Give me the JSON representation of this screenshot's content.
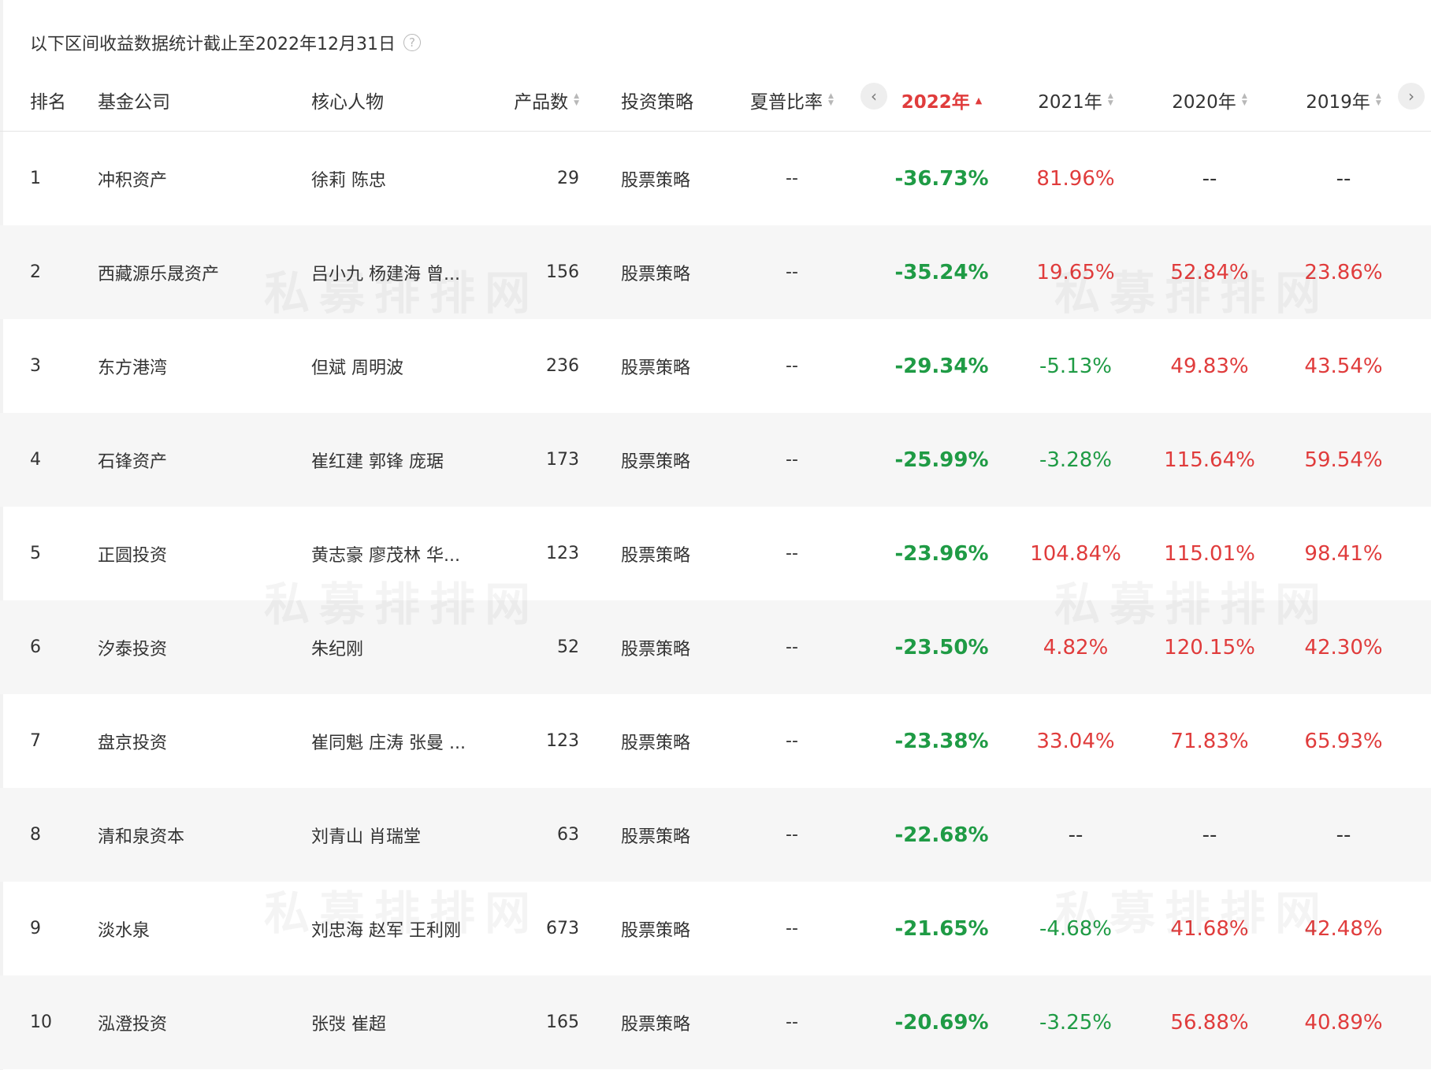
{
  "note": "以下区间收益数据统计截止至2022年12月31日",
  "help_icon": "?",
  "headers": {
    "rank": "排名",
    "company": "基金公司",
    "people": "核心人物",
    "count": "产品数",
    "strategy": "投资策略",
    "sharpe": "夏普比率",
    "y2022": "2022年",
    "y2021": "2021年",
    "y2020": "2020年",
    "y2019": "2019年"
  },
  "nav": {
    "prev": "‹",
    "next": "›"
  },
  "sort_glyphs": {
    "up": "▲",
    "down": "▼"
  },
  "watermark": "私募排排网",
  "colors": {
    "positive": "#e03c3c",
    "negative": "#1f9b45",
    "active_sort": "#e03c3c"
  },
  "rows": [
    {
      "rank": "1",
      "company": "冲积资产",
      "people": "徐莉 陈忠",
      "count": "29",
      "strategy": "股票策略",
      "sharpe": "--",
      "y2022": "-36.73%",
      "y2021": "81.96%",
      "y2020": "--",
      "y2019": "--"
    },
    {
      "rank": "2",
      "company": "西藏源乐晟资产",
      "people": "吕小九 杨建海 曾...",
      "count": "156",
      "strategy": "股票策略",
      "sharpe": "--",
      "y2022": "-35.24%",
      "y2021": "19.65%",
      "y2020": "52.84%",
      "y2019": "23.86%"
    },
    {
      "rank": "3",
      "company": "东方港湾",
      "people": "但斌 周明波",
      "count": "236",
      "strategy": "股票策略",
      "sharpe": "--",
      "y2022": "-29.34%",
      "y2021": "-5.13%",
      "y2020": "49.83%",
      "y2019": "43.54%"
    },
    {
      "rank": "4",
      "company": "石锋资产",
      "people": "崔红建 郭锋 庞琚",
      "count": "173",
      "strategy": "股票策略",
      "sharpe": "--",
      "y2022": "-25.99%",
      "y2021": "-3.28%",
      "y2020": "115.64%",
      "y2019": "59.54%"
    },
    {
      "rank": "5",
      "company": "正圆投资",
      "people": "黄志豪 廖茂林 华...",
      "count": "123",
      "strategy": "股票策略",
      "sharpe": "--",
      "y2022": "-23.96%",
      "y2021": "104.84%",
      "y2020": "115.01%",
      "y2019": "98.41%"
    },
    {
      "rank": "6",
      "company": "汐泰投资",
      "people": "朱纪刚",
      "count": "52",
      "strategy": "股票策略",
      "sharpe": "--",
      "y2022": "-23.50%",
      "y2021": "4.82%",
      "y2020": "120.15%",
      "y2019": "42.30%"
    },
    {
      "rank": "7",
      "company": "盘京投资",
      "people": "崔同魁 庄涛 张曼 ...",
      "count": "123",
      "strategy": "股票策略",
      "sharpe": "--",
      "y2022": "-23.38%",
      "y2021": "33.04%",
      "y2020": "71.83%",
      "y2019": "65.93%"
    },
    {
      "rank": "8",
      "company": "清和泉资本",
      "people": "刘青山 肖瑞堂",
      "count": "63",
      "strategy": "股票策略",
      "sharpe": "--",
      "y2022": "-22.68%",
      "y2021": "--",
      "y2020": "--",
      "y2019": "--"
    },
    {
      "rank": "9",
      "company": "淡水泉",
      "people": "刘忠海 赵军 王利刚",
      "count": "673",
      "strategy": "股票策略",
      "sharpe": "--",
      "y2022": "-21.65%",
      "y2021": "-4.68%",
      "y2020": "41.68%",
      "y2019": "42.48%"
    },
    {
      "rank": "10",
      "company": "泓澄投资",
      "people": "张弢 崔超",
      "count": "165",
      "strategy": "股票策略",
      "sharpe": "--",
      "y2022": "-20.69%",
      "y2021": "-3.25%",
      "y2020": "56.88%",
      "y2019": "40.89%"
    }
  ]
}
